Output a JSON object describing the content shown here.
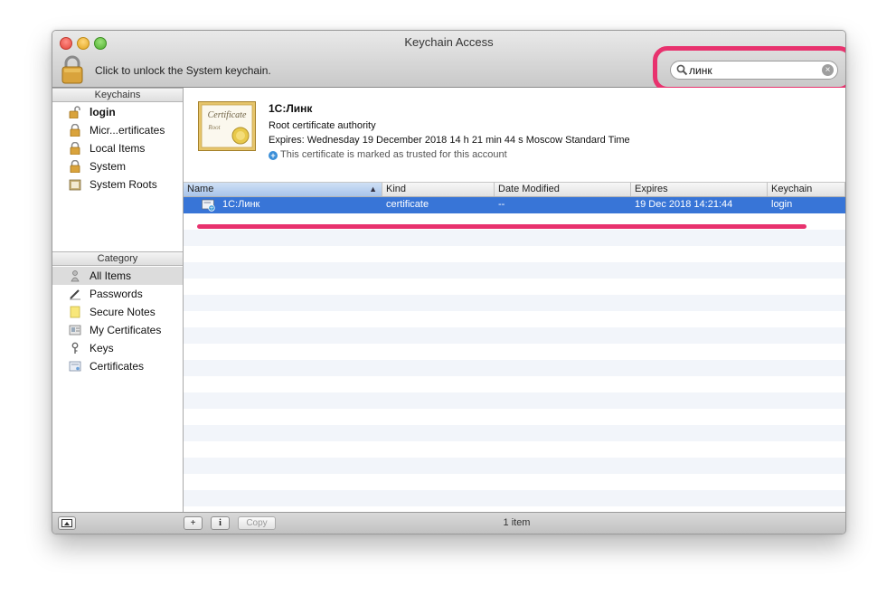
{
  "window": {
    "title": "Keychain Access"
  },
  "toolbar": {
    "unlock_text": "Click to unlock the System keychain.",
    "search": {
      "value": "линк",
      "placeholder": ""
    }
  },
  "sidebar": {
    "keychains_header": "Keychains",
    "keychains": [
      {
        "label": "login",
        "icon": "unlocked-padlock-icon",
        "bold": true
      },
      {
        "label": "Micr...ertificates",
        "icon": "padlock-icon"
      },
      {
        "label": "Local Items",
        "icon": "padlock-icon"
      },
      {
        "label": "System",
        "icon": "padlock-icon"
      },
      {
        "label": "System Roots",
        "icon": "folder-icon"
      }
    ],
    "category_header": "Category",
    "categories": [
      {
        "label": "All Items",
        "icon": "people-icon",
        "selected": true
      },
      {
        "label": "Passwords",
        "icon": "pencil-icon"
      },
      {
        "label": "Secure Notes",
        "icon": "note-icon"
      },
      {
        "label": "My Certificates",
        "icon": "id-card-icon"
      },
      {
        "label": "Keys",
        "icon": "key-icon"
      },
      {
        "label": "Certificates",
        "icon": "certificate-icon"
      }
    ]
  },
  "details": {
    "name": "1С:Линк",
    "type": "Root certificate authority",
    "expires": "Expires: Wednesday 19 December 2018 14 h 21 min 44 s Moscow Standard Time",
    "trust": "This certificate is marked as trusted for this account",
    "thumb_text": "Certificate",
    "thumb_sub": "Root"
  },
  "table": {
    "columns": [
      "Name",
      "Kind",
      "Date Modified",
      "Expires",
      "Keychain"
    ],
    "rows": [
      {
        "name": "1С:Линк",
        "kind": "certificate",
        "date_modified": "--",
        "expires": "19 Dec 2018 14:21:44",
        "keychain": "login"
      }
    ]
  },
  "bottom": {
    "add_label": "+",
    "info_label": "i",
    "copy_label": "Copy",
    "status": "1 item"
  },
  "colors": {
    "selection": "#3875d7",
    "annotation": "#e8326e"
  }
}
